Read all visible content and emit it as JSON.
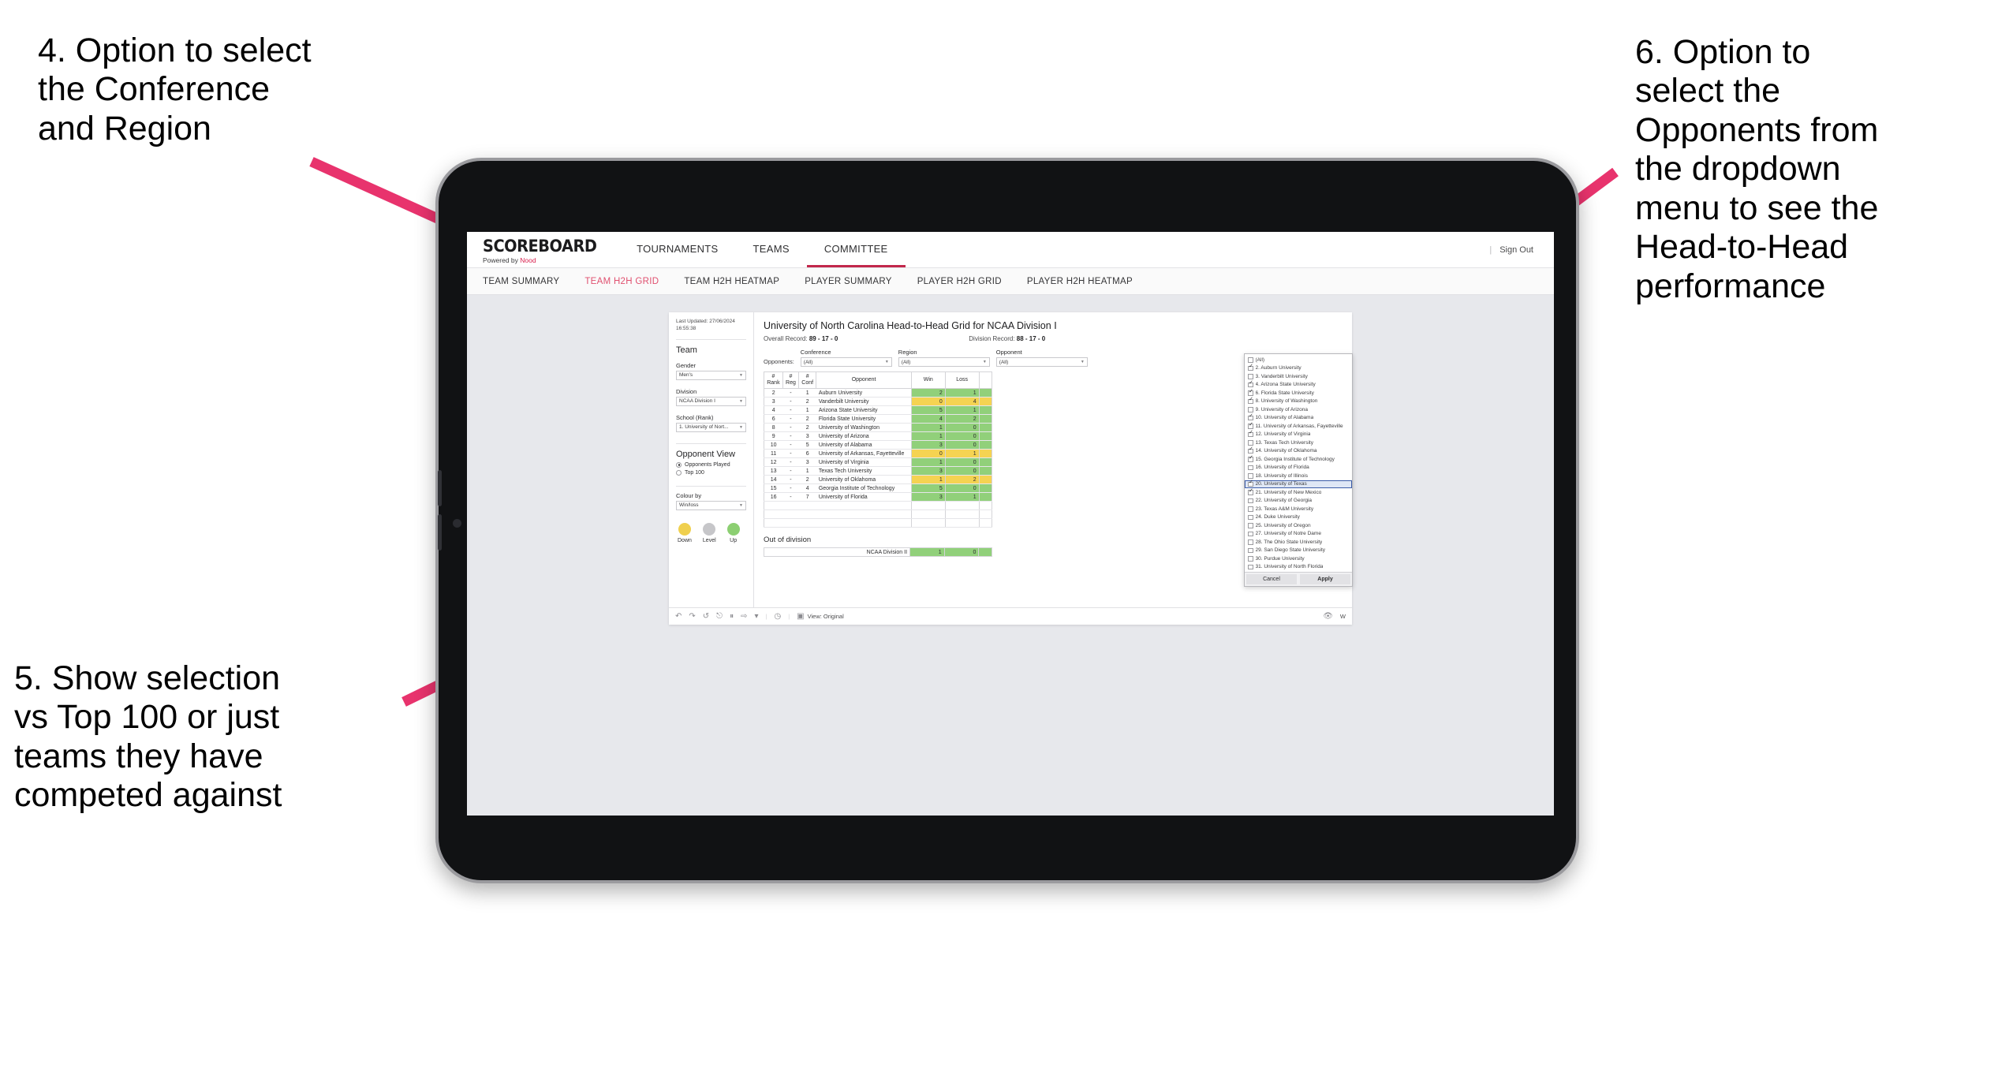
{
  "annotations": {
    "left_top": "4. Option to select\nthe Conference\nand Region",
    "left_bottom": "5. Show selection\nvs Top 100 or just\nteams they have\ncompeted against",
    "right": "6. Option to\nselect the\nOpponents from\nthe dropdown\nmenu to see the\nHead-to-Head\nperformance"
  },
  "app": {
    "logo_main": "SCOREBOARD",
    "logo_sub_prefix": "Powered by ",
    "logo_sub_brand": "Nood",
    "nav": [
      {
        "label": "TOURNAMENTS",
        "active": false
      },
      {
        "label": "TEAMS",
        "active": false
      },
      {
        "label": "COMMITTEE",
        "active": true
      }
    ],
    "header_right": {
      "separator": "|",
      "sign_out": "Sign Out"
    },
    "sub_nav": [
      {
        "label": "TEAM SUMMARY",
        "active": false
      },
      {
        "label": "TEAM H2H GRID",
        "active": true
      },
      {
        "label": "TEAM H2H HEATMAP",
        "active": false
      },
      {
        "label": "PLAYER SUMMARY",
        "active": false
      },
      {
        "label": "PLAYER H2H GRID",
        "active": false
      },
      {
        "label": "PLAYER H2H HEATMAP",
        "active": false
      }
    ]
  },
  "rail": {
    "last_updated": "Last Updated: 27/06/2024 16:55:38",
    "team_heading": "Team",
    "gender": {
      "label": "Gender",
      "value": "Men's"
    },
    "division": {
      "label": "Division",
      "value": "NCAA Division I"
    },
    "school": {
      "label": "School (Rank)",
      "value": "1. University of Nort..."
    },
    "opponent_view": {
      "heading": "Opponent View",
      "options": [
        {
          "label": "Opponents Played",
          "selected": true
        },
        {
          "label": "Top 100",
          "selected": false
        }
      ]
    },
    "colour_by": {
      "label": "Colour by",
      "value": "Win/loss"
    },
    "legend": [
      {
        "label": "Down",
        "color": "#f0d04e"
      },
      {
        "label": "Level",
        "color": "#c6c6c9"
      },
      {
        "label": "Up",
        "color": "#8ccf72"
      }
    ]
  },
  "viz": {
    "title": "University of North Carolina Head-to-Head Grid for NCAA Division I",
    "overall_record_label": "Overall Record:",
    "overall_record_value": "89 - 17 - 0",
    "division_record_label": "Division Record:",
    "division_record_value": "88 - 17 - 0",
    "opponents_label": "Opponents:",
    "filters": [
      {
        "label": "Conference",
        "value": "(All)"
      },
      {
        "label": "Region",
        "value": "(All)"
      },
      {
        "label": "Opponent",
        "value": "(All)"
      }
    ],
    "table_headers": [
      "#\nRank",
      "#\nReg",
      "#\nConf",
      "Opponent",
      "Win",
      "Loss",
      ""
    ],
    "rows": [
      {
        "rank": "2",
        "reg": "-",
        "conf": "1",
        "opponent": "Auburn University",
        "win": "2",
        "loss": "1",
        "state": "up"
      },
      {
        "rank": "3",
        "reg": "-",
        "conf": "2",
        "opponent": "Vanderbilt University",
        "win": "0",
        "loss": "4",
        "state": "down"
      },
      {
        "rank": "4",
        "reg": "-",
        "conf": "1",
        "opponent": "Arizona State University",
        "win": "5",
        "loss": "1",
        "state": "up"
      },
      {
        "rank": "6",
        "reg": "-",
        "conf": "2",
        "opponent": "Florida State University",
        "win": "4",
        "loss": "2",
        "state": "up"
      },
      {
        "rank": "8",
        "reg": "-",
        "conf": "2",
        "opponent": "University of Washington",
        "win": "1",
        "loss": "0",
        "state": "up"
      },
      {
        "rank": "9",
        "reg": "-",
        "conf": "3",
        "opponent": "University of Arizona",
        "win": "1",
        "loss": "0",
        "state": "up"
      },
      {
        "rank": "10",
        "reg": "-",
        "conf": "5",
        "opponent": "University of Alabama",
        "win": "3",
        "loss": "0",
        "state": "up"
      },
      {
        "rank": "11",
        "reg": "-",
        "conf": "6",
        "opponent": "University of Arkansas, Fayetteville",
        "win": "0",
        "loss": "1",
        "state": "down"
      },
      {
        "rank": "12",
        "reg": "-",
        "conf": "3",
        "opponent": "University of Virginia",
        "win": "1",
        "loss": "0",
        "state": "up"
      },
      {
        "rank": "13",
        "reg": "-",
        "conf": "1",
        "opponent": "Texas Tech University",
        "win": "3",
        "loss": "0",
        "state": "up"
      },
      {
        "rank": "14",
        "reg": "-",
        "conf": "2",
        "opponent": "University of Oklahoma",
        "win": "1",
        "loss": "2",
        "state": "down"
      },
      {
        "rank": "15",
        "reg": "-",
        "conf": "4",
        "opponent": "Georgia Institute of Technology",
        "win": "5",
        "loss": "0",
        "state": "up"
      },
      {
        "rank": "16",
        "reg": "-",
        "conf": "7",
        "opponent": "University of Florida",
        "win": "3",
        "loss": "1",
        "state": "up"
      }
    ],
    "out_of_division": {
      "title": "Out of division",
      "row": {
        "label": "NCAA Division II",
        "win": "1",
        "loss": "0",
        "state": "up"
      }
    }
  },
  "opponent_dropdown": {
    "items": [
      {
        "label": "(All)",
        "checked": false,
        "highlighted": false
      },
      {
        "label": "2. Auburn University",
        "checked": true,
        "highlighted": false
      },
      {
        "label": "3. Vanderbilt University",
        "checked": false,
        "highlighted": false
      },
      {
        "label": "4. Arizona State University",
        "checked": true,
        "highlighted": false
      },
      {
        "label": "6. Florida State University",
        "checked": true,
        "highlighted": false
      },
      {
        "label": "8. University of Washington",
        "checked": true,
        "highlighted": false
      },
      {
        "label": "9. University of Arizona",
        "checked": false,
        "highlighted": false
      },
      {
        "label": "10. University of Alabama",
        "checked": true,
        "highlighted": false
      },
      {
        "label": "11. University of Arkansas, Fayetteville",
        "checked": true,
        "highlighted": false
      },
      {
        "label": "12. University of Virginia",
        "checked": true,
        "highlighted": false
      },
      {
        "label": "13. Texas Tech University",
        "checked": false,
        "highlighted": false
      },
      {
        "label": "14. University of Oklahoma",
        "checked": true,
        "highlighted": false
      },
      {
        "label": "15. Georgia Institute of Technology",
        "checked": true,
        "highlighted": false
      },
      {
        "label": "16. University of Florida",
        "checked": false,
        "highlighted": false
      },
      {
        "label": "18. University of Illinois",
        "checked": false,
        "highlighted": false
      },
      {
        "label": "20. University of Texas",
        "checked": true,
        "highlighted": true
      },
      {
        "label": "21. University of New Mexico",
        "checked": true,
        "highlighted": false
      },
      {
        "label": "22. University of Georgia",
        "checked": false,
        "highlighted": false
      },
      {
        "label": "23. Texas A&M University",
        "checked": false,
        "highlighted": false
      },
      {
        "label": "24. Duke University",
        "checked": false,
        "highlighted": false
      },
      {
        "label": "25. University of Oregon",
        "checked": false,
        "highlighted": false
      },
      {
        "label": "27. University of Notre Dame",
        "checked": false,
        "highlighted": false
      },
      {
        "label": "28. The Ohio State University",
        "checked": false,
        "highlighted": false
      },
      {
        "label": "29. San Diego State University",
        "checked": false,
        "highlighted": false
      },
      {
        "label": "30. Purdue University",
        "checked": false,
        "highlighted": false
      },
      {
        "label": "31. University of North Florida",
        "checked": false,
        "highlighted": false
      }
    ],
    "cancel_label": "Cancel",
    "apply_label": "Apply"
  },
  "toolbar": {
    "undo": "↶",
    "redo": "↷",
    "revert": "↺",
    "refresh": "⎋",
    "pause": "⏸",
    "share": "⇨",
    "caret": "▾",
    "divider": "|",
    "clock": "◷",
    "view_label": "View: Original",
    "eye": "👁",
    "watch_label": "W"
  },
  "colors": {
    "brand_red": "#c2274b",
    "active_tab": "#e0506f",
    "up": "#91d07a",
    "down": "#f5d352",
    "level": "#c9c9cc",
    "annotation_arrow": "#e8336d"
  }
}
